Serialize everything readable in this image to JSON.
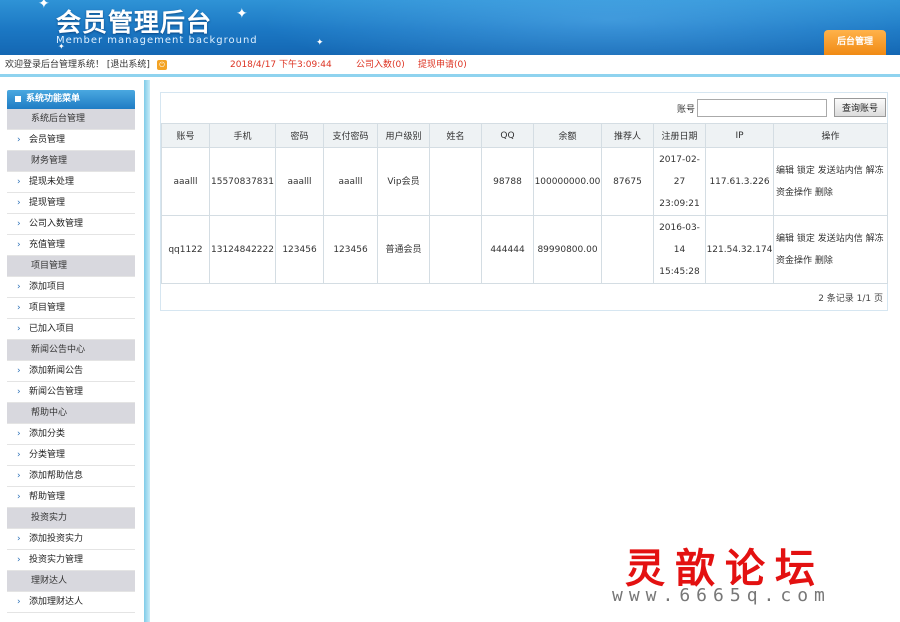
{
  "header": {
    "title_cn": "会员管理后台",
    "title_en": "Member management background",
    "admin_tab": "后台管理"
  },
  "infobar": {
    "welcome": "欢迎登录后台管理系统！ [退出系统]",
    "time": "2018/4/17 下午3:09:44",
    "company_count": "公司入数(0)",
    "withdraw_apply": "提现申请(0)"
  },
  "menu": {
    "title": "系统功能菜单",
    "items": [
      {
        "type": "group",
        "label": "系统后台管理"
      },
      {
        "type": "link",
        "label": "会员管理"
      },
      {
        "type": "group",
        "label": "财务管理"
      },
      {
        "type": "link",
        "label": "提现未处理"
      },
      {
        "type": "link",
        "label": "提现管理"
      },
      {
        "type": "link",
        "label": "公司入数管理"
      },
      {
        "type": "link",
        "label": "充值管理"
      },
      {
        "type": "group",
        "label": "项目管理"
      },
      {
        "type": "link",
        "label": "添加项目"
      },
      {
        "type": "link",
        "label": "项目管理"
      },
      {
        "type": "link",
        "label": "已加入项目"
      },
      {
        "type": "group",
        "label": "新闻公告中心"
      },
      {
        "type": "link",
        "label": "添加新闻公告"
      },
      {
        "type": "link",
        "label": "新闻公告管理"
      },
      {
        "type": "group",
        "label": "帮助中心"
      },
      {
        "type": "link",
        "label": "添加分类"
      },
      {
        "type": "link",
        "label": "分类管理"
      },
      {
        "type": "link",
        "label": "添加帮助信息"
      },
      {
        "type": "link",
        "label": "帮助管理"
      },
      {
        "type": "group",
        "label": "投资实力"
      },
      {
        "type": "link",
        "label": "添加投资实力"
      },
      {
        "type": "link",
        "label": "投资实力管理"
      },
      {
        "type": "group",
        "label": "理财达人"
      },
      {
        "type": "link",
        "label": "添加理财达人"
      }
    ]
  },
  "search": {
    "label": "账号",
    "placeholder": "",
    "button": "查询账号"
  },
  "table": {
    "columns": [
      "账号",
      "手机",
      "密码",
      "支付密码",
      "用户级别",
      "姓名",
      "QQ",
      "余额",
      "推荐人",
      "注册日期",
      "IP",
      "操作"
    ],
    "rows": [
      {
        "account": "aaalll",
        "phone": "15570837831",
        "password": "aaalll",
        "pay_password": "aaalll",
        "level": "Vip会员",
        "name": "",
        "qq": "98788",
        "balance": "100000000.00",
        "referrer": "87675",
        "reg_date": "2017-02-27 23:09:21",
        "ip": "117.61.3.226"
      },
      {
        "account": "qq1122",
        "phone": "13124842222",
        "password": "123456",
        "pay_password": "123456",
        "level": "普通会员",
        "name": "",
        "qq": "444444",
        "balance": "89990800.00",
        "referrer": "",
        "reg_date": "2016-03-14 15:45:28",
        "ip": "121.54.32.174"
      }
    ],
    "ops": [
      "编辑",
      "锁定",
      "发送站内信",
      "解冻",
      "资金操作",
      "删除"
    ]
  },
  "pager": "2 条记录 1/1 页",
  "watermark": {
    "cn": "灵歆论坛",
    "url": "www.6665q.com"
  }
}
